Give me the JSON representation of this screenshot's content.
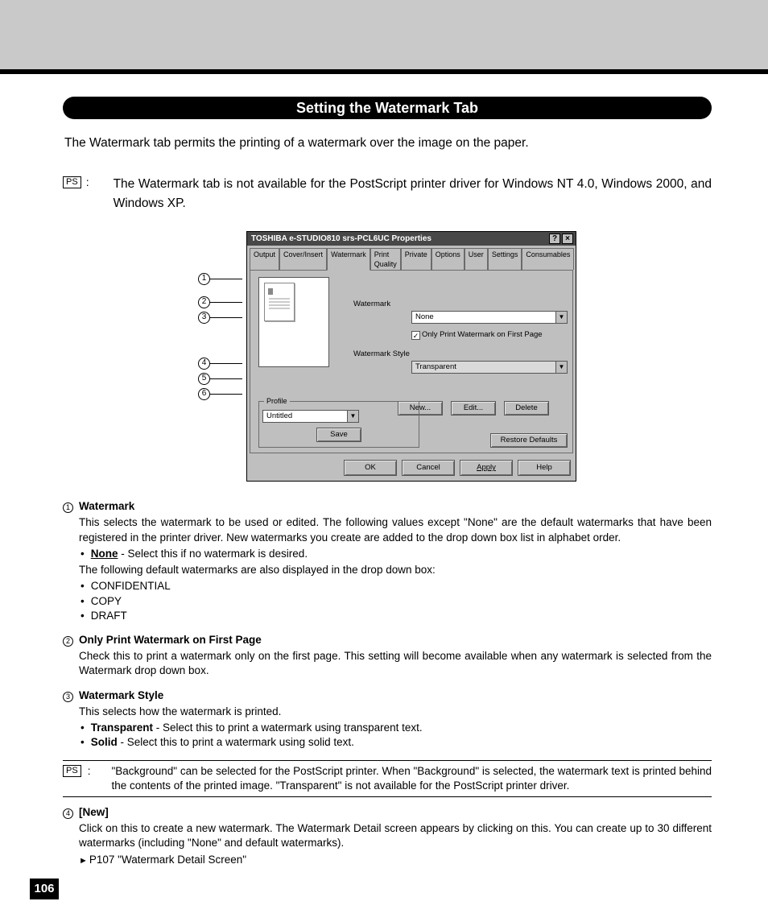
{
  "page": {
    "section_title": "Setting the Watermark Tab",
    "intro": "The Watermark tab permits the printing of a watermark over the image on the paper.",
    "ps_label": "PS",
    "ps_note_top": "The Watermark tab is not available for the PostScript printer driver for Windows NT 4.0, Windows 2000, and Windows XP.",
    "page_number": "106"
  },
  "dialog": {
    "title": "TOSHIBA e-STUDIO810 srs-PCL6UC Properties",
    "help_icon": "?",
    "close_icon": "×",
    "tabs": [
      "Output",
      "Cover/Insert",
      "Watermark",
      "Print Quality",
      "Private",
      "Options",
      "User",
      "Settings",
      "Consumables"
    ],
    "active_tab_index": 2,
    "labels": {
      "watermark": "Watermark",
      "only_first": "Only Print Watermark on First Page",
      "style": "Watermark Style"
    },
    "values": {
      "watermark": "None",
      "only_first_checked": "✓",
      "style": "Transparent",
      "profile": "Untitled"
    },
    "buttons": {
      "new": "New...",
      "edit": "Edit...",
      "delete": "Delete",
      "save": "Save",
      "restore": "Restore Defaults",
      "ok": "OK",
      "cancel": "Cancel",
      "apply": "Apply",
      "help": "Help"
    },
    "profile_legend": "Profile"
  },
  "callouts": [
    "1",
    "2",
    "3",
    "4",
    "5",
    "6"
  ],
  "desc": {
    "i1": {
      "title": "Watermark",
      "p1": "This selects the watermark to be used or edited.  The following values except \"None\" are the default watermarks that have been registered in the printer driver.  New watermarks you create are added to the drop down box list in alphabet order.",
      "none_label": "None",
      "none_text": " - Select this if no watermark is desired.",
      "p2": "The following default watermarks are also displayed in the drop down box:",
      "opts": [
        "CONFIDENTIAL",
        "COPY",
        "DRAFT"
      ]
    },
    "i2": {
      "title": "Only Print Watermark on First Page",
      "p1": "Check this to print a watermark only on the first page.  This setting will become available when any watermark is selected from the Watermark drop down box."
    },
    "i3": {
      "title": "Watermark Style",
      "p1": "This selects how the watermark is printed.",
      "opt1_label": "Transparent",
      "opt1_text": " - Select this to print a watermark using transparent text.",
      "opt2_label": "Solid",
      "opt2_text": " - Select this to print a watermark using solid text."
    },
    "ps_mid": "\"Background\" can be selected for the PostScript printer.  When \"Background\" is selected, the watermark text is printed behind the contents of the printed image.  \"Transparent\" is not available for the PostScript printer driver.",
    "i4": {
      "title": "[New]",
      "p1": "Click on this to create a new watermark.  The Watermark Detail screen appears by clicking on this.  You can create up to 30 different watermarks (including \"None\" and default watermarks).",
      "ref": "P107 \"Watermark Detail Screen\""
    }
  }
}
